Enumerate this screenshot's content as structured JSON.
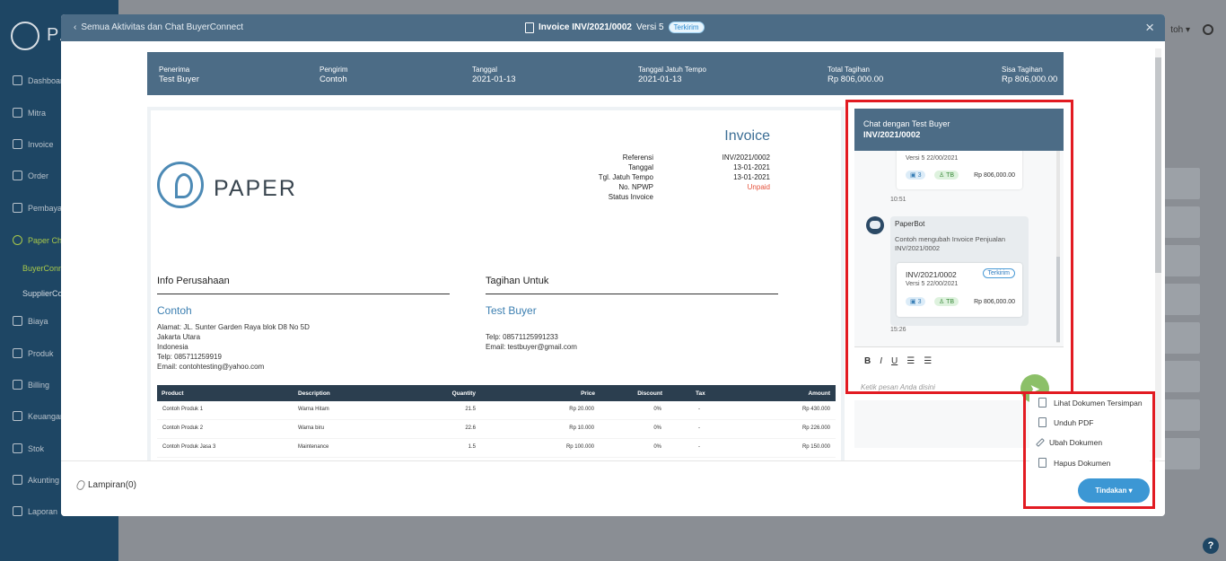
{
  "app": {
    "logo_text": "PA",
    "user_label": "toh ▾"
  },
  "sidebar": {
    "items": [
      {
        "label": "Dashboard"
      },
      {
        "label": "Mitra"
      },
      {
        "label": "Invoice"
      },
      {
        "label": "Order"
      },
      {
        "label": "Pembayaran"
      },
      {
        "label": "Paper Chat"
      },
      {
        "label": "Biaya"
      },
      {
        "label": "Produk"
      },
      {
        "label": "Billing"
      },
      {
        "label": "Keuangan"
      },
      {
        "label": "Stok"
      },
      {
        "label": "Akunting"
      },
      {
        "label": "Laporan"
      }
    ],
    "sub_items": [
      {
        "label": "BuyerConnect"
      },
      {
        "label": "SupplierConnect"
      }
    ]
  },
  "modal": {
    "back_link": "Semua Aktivitas dan Chat BuyerConnect",
    "title": "Invoice INV/2021/0002",
    "version": "Versi 5",
    "status_badge": "Terkirim",
    "close": "×"
  },
  "summary": {
    "penerima_label": "Penerima",
    "penerima_value": "Test Buyer",
    "pengirim_label": "Pengirim",
    "pengirim_value": "Contoh",
    "tanggal_label": "Tanggal",
    "tanggal_value": "2021-01-13",
    "jatuh_tempo_label": "Tanggal Jatuh Tempo",
    "jatuh_tempo_value": "2021-01-13",
    "total_label": "Total Tagihan",
    "total_value": "Rp 806,000.00",
    "sisa_label": "Sisa Tagihan",
    "sisa_value": "Rp 806,000.00"
  },
  "invoice": {
    "logo_text": "PAPER",
    "title": "Invoice",
    "meta_labels": [
      "Referensi",
      "Tanggal",
      "Tgl. Jatuh Tempo",
      "No. NPWP",
      "Status Invoice"
    ],
    "meta_values": [
      "INV/2021/0002",
      "13-01-2021",
      "13-01-2021",
      "",
      "Unpaid"
    ],
    "company_section": "Info Perusahaan",
    "company_name": "Contoh",
    "company_address": [
      "Alamat: JL. Sunter Garden Raya blok D8 No 5D",
      "Jakarta Utara",
      "Indonesia",
      "Telp: 085711259919",
      "Email: contohtesting@yahoo.com"
    ],
    "bill_section": "Tagihan Untuk",
    "bill_name": "Test Buyer",
    "bill_address": [
      "Telp: 08571125991233",
      "Email: testbuyer@gmail.com"
    ],
    "table": {
      "headers": [
        "Product",
        "Description",
        "Quantity",
        "Price",
        "Discount",
        "Tax",
        "Amount"
      ],
      "rows": [
        [
          "Contoh Produk 1",
          "Warna Hitam",
          "21.5",
          "Rp 20.000",
          "0%",
          "-",
          "Rp 430.000"
        ],
        [
          "Contoh Produk 2",
          "Warna biru",
          "22.6",
          "Rp 10.000",
          "0%",
          "-",
          "Rp 226.000"
        ],
        [
          "Contoh Produk Jasa 3",
          "Maintenance",
          "1.5",
          "Rp 100.000",
          "0%",
          "-",
          "Rp 150.000"
        ]
      ]
    }
  },
  "chat": {
    "header_line1": "Chat dengan Test Buyer",
    "header_line2": "INV/2021/0002",
    "card1": {
      "version": "Versi 5   22/00/2021",
      "qty": "3",
      "tb": "TB",
      "amount": "Rp 806,000.00"
    },
    "time1": "10:51",
    "bot_name": "PaperBot",
    "bot_message": "Contoh mengubah Invoice Penjualan INV/2021/0002",
    "card2": {
      "title": "INV/2021/0002",
      "badge": "Terkirim",
      "version": "Versi 5   22/00/2021",
      "qty": "3",
      "tb": "TB",
      "amount": "Rp 806,000.00"
    },
    "time2": "15:26",
    "tools": [
      "B",
      "I",
      "U",
      "☰",
      "☰"
    ],
    "input_placeholder": "Ketik pesan Anda disini"
  },
  "footer": {
    "attachments": "Lampiran(0)",
    "action_button": "Tindakan ▾"
  },
  "dropdown": {
    "items": [
      {
        "label": "Lihat Dokumen Tersimpan",
        "icon": "document-icon"
      },
      {
        "label": "Unduh PDF",
        "icon": "pdf-icon"
      },
      {
        "label": "Ubah Dokumen",
        "icon": "pencil-icon"
      },
      {
        "label": "Hapus Dokumen",
        "icon": "trash-icon"
      }
    ]
  },
  "help_label": "?",
  "colors": {
    "sidebar": "#1e4664",
    "header": "#4c6c86",
    "accent": "#3c97d4",
    "highlight": "#e21b22",
    "unpaid": "#e5533d",
    "send": "#8cc068"
  }
}
